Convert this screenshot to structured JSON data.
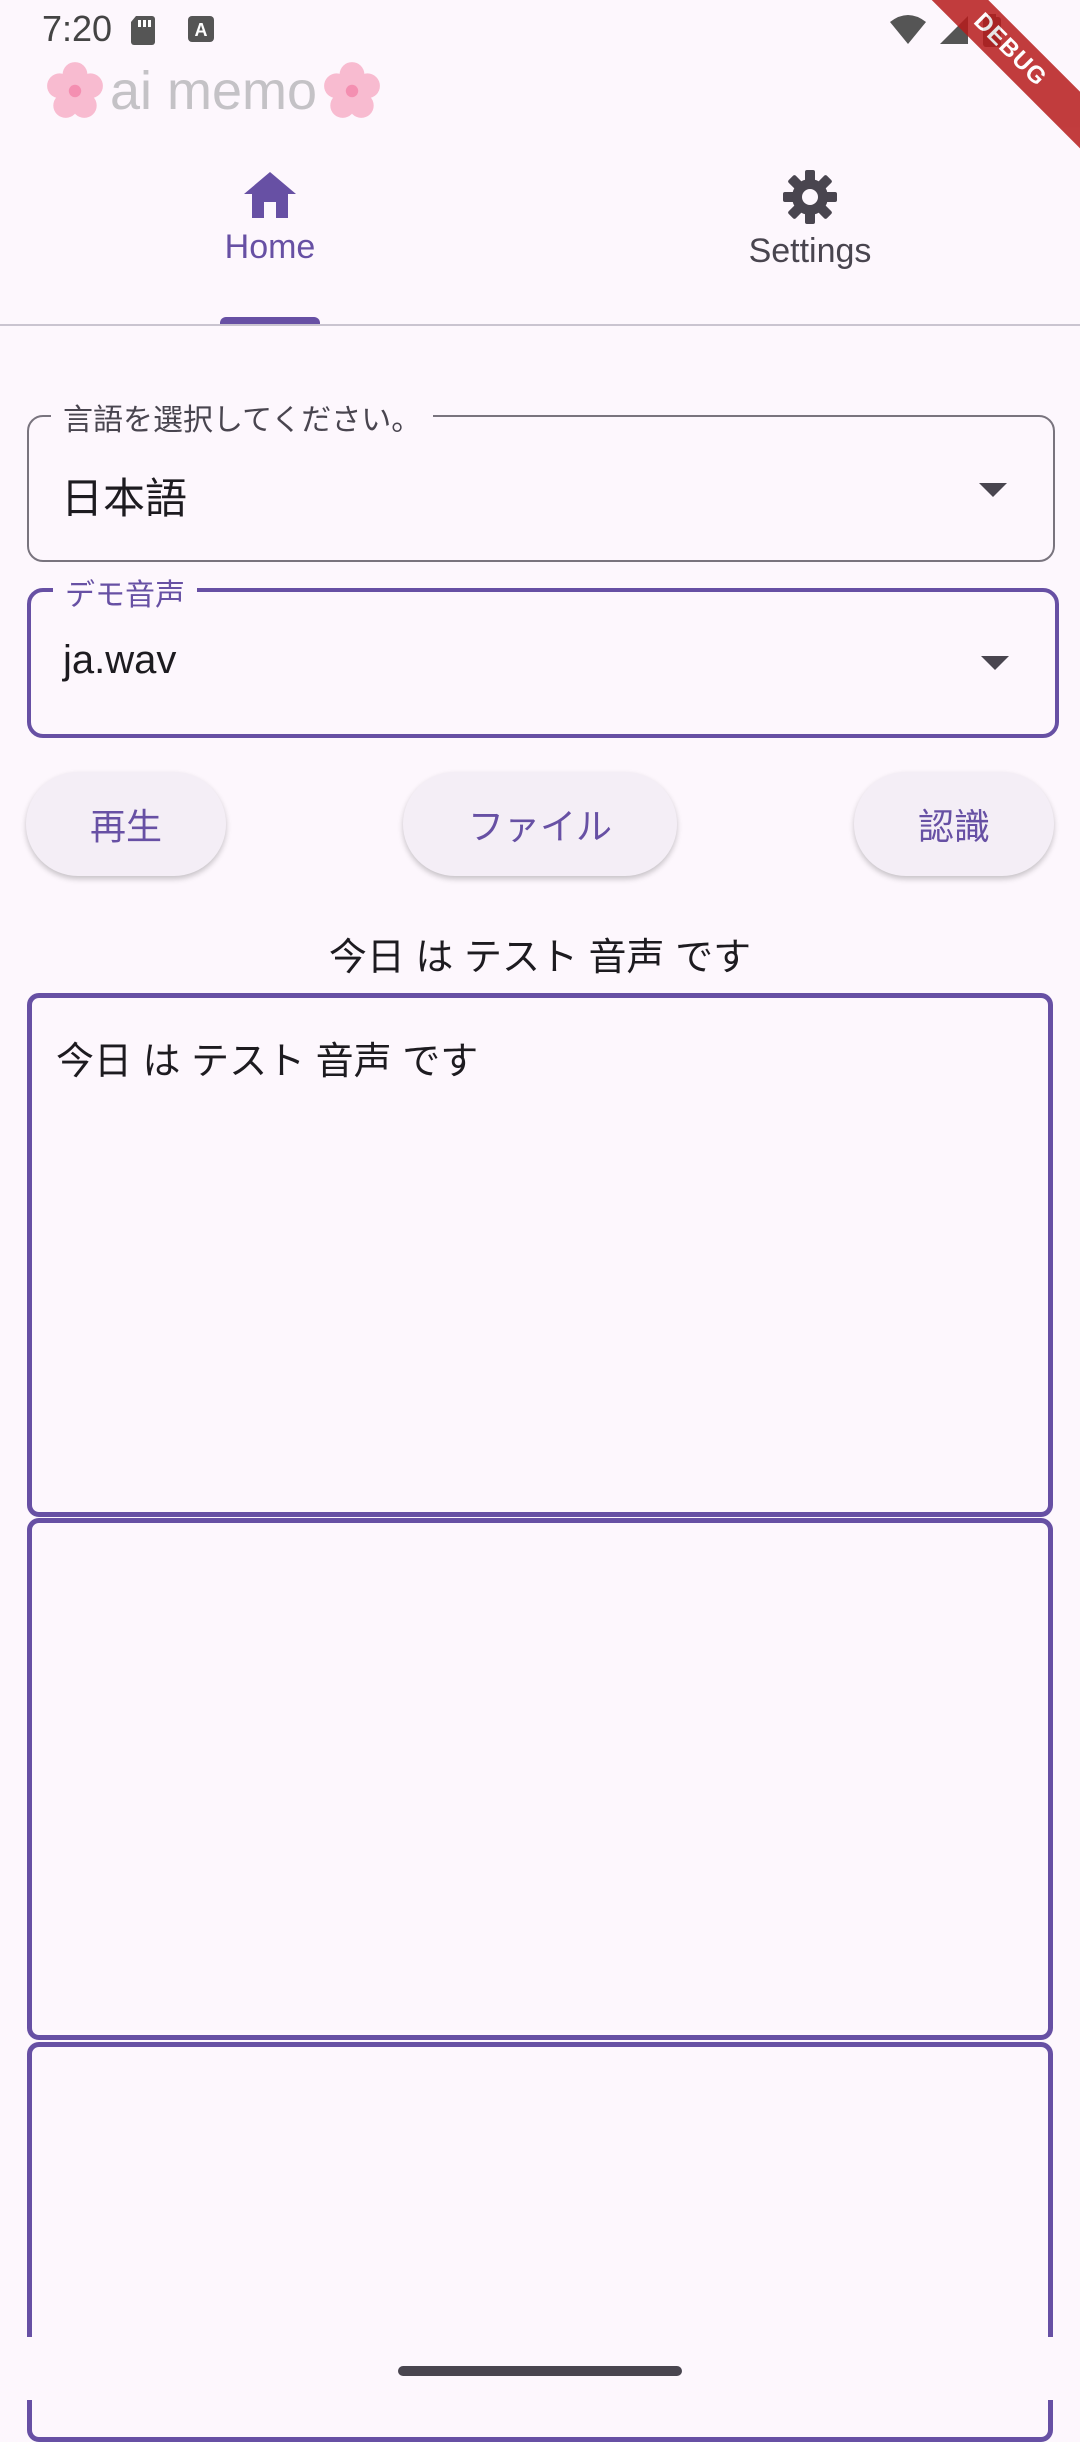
{
  "status_bar": {
    "time": "7:20"
  },
  "debug_label": "DEBUG",
  "app": {
    "title": "ai memo"
  },
  "tabs": [
    {
      "label": "Home",
      "icon": "home-icon",
      "active": true
    },
    {
      "label": "Settings",
      "icon": "gear-icon",
      "active": false
    }
  ],
  "language_field": {
    "label": "言語を選択してください。",
    "value": "日本語"
  },
  "demo_field": {
    "label": "デモ音声",
    "value": "ja.wav"
  },
  "buttons": {
    "play": "再生",
    "file": "ファイル",
    "recognize": "認識"
  },
  "result_text": "今日 は テスト 音声 です",
  "textareas": [
    {
      "value": "今日 は テスト 音声 です"
    },
    {
      "value": ""
    },
    {
      "value": ""
    }
  ],
  "colors": {
    "primary": "#6750a4",
    "background": "#fdf7fd",
    "debug": "#b71c1c"
  }
}
